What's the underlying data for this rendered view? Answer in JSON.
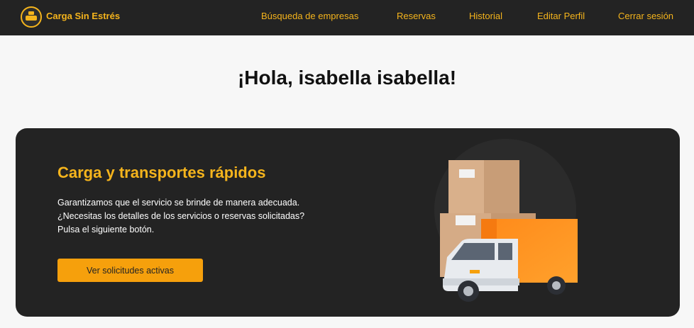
{
  "navbar": {
    "brand": "Carga Sin Estrés",
    "links": [
      {
        "label": "Búsqueda de empresas"
      },
      {
        "label": "Reservas"
      },
      {
        "label": "Historial"
      },
      {
        "label": "Editar Perfil"
      },
      {
        "label": "Cerrar sesión"
      }
    ]
  },
  "greeting": "¡Hola, isabella isabella!",
  "hero": {
    "title": "Carga y transportes rápidos",
    "text_lines": [
      "Garantizamos que el servicio se brinde de manera adecuada.",
      "¿Necesitas los detalles de los servicios o reservas solicitadas?",
      "Pulsa el siguiente botón."
    ],
    "button_label": "Ver solicitudes activas",
    "illustration": "delivery-truck-with-boxes"
  },
  "colors": {
    "accent": "#f5b41c",
    "button": "#f6a00c",
    "dark": "#232323",
    "background": "#f7f7f7"
  }
}
